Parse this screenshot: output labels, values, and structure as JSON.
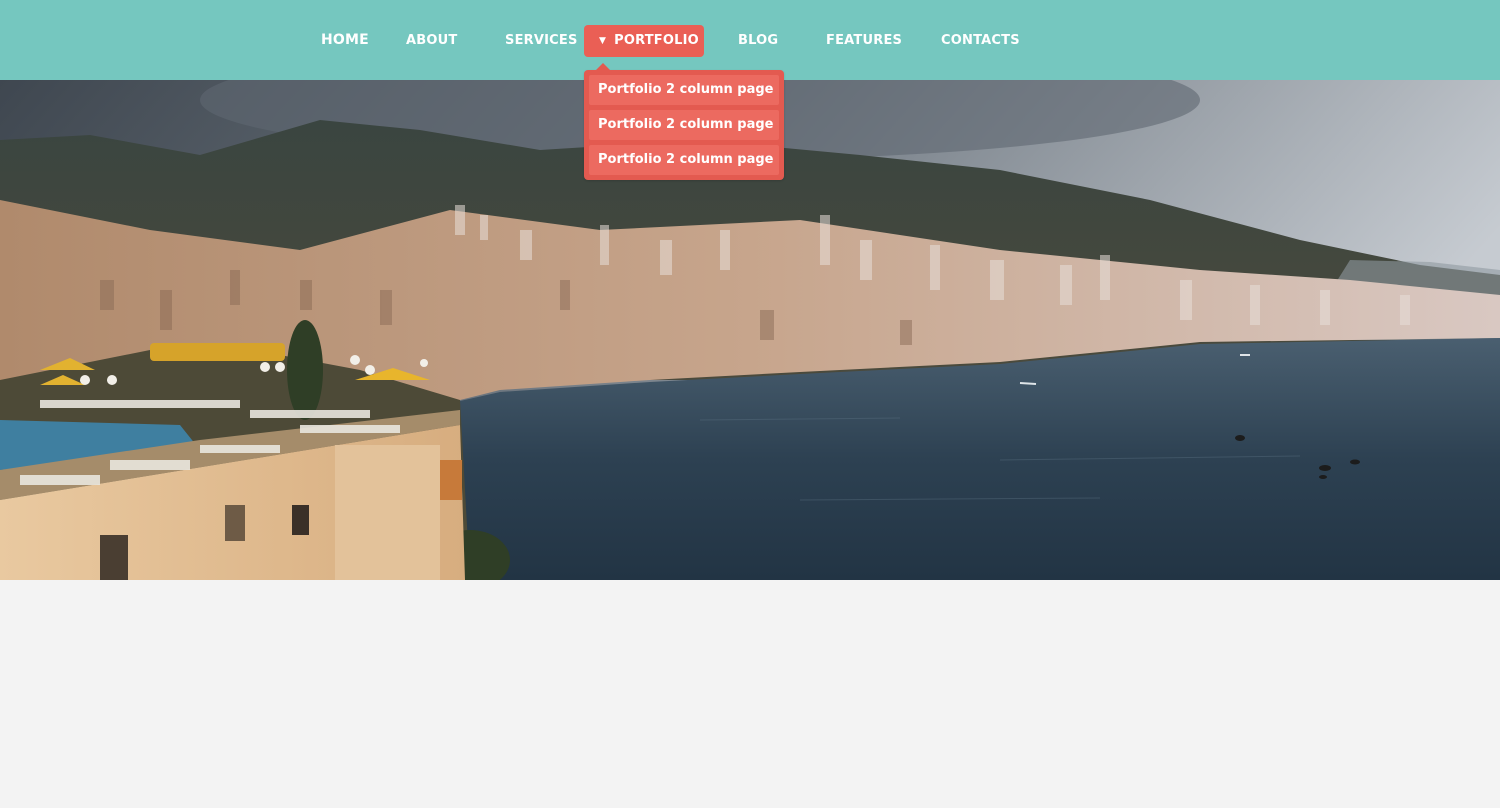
{
  "nav": {
    "items": [
      {
        "label": "HOME"
      },
      {
        "label": "ABOUT"
      },
      {
        "label": "SERVICES"
      },
      {
        "label": "PORTFOLIO"
      },
      {
        "label": "BLOG"
      },
      {
        "label": "FEATURES"
      },
      {
        "label": "CONTACTS"
      }
    ],
    "active_index": 3,
    "dropdown": [
      {
        "label": "Portfolio 2 column page"
      },
      {
        "label": "Portfolio 2 column page"
      },
      {
        "label": "Portfolio 2 column page"
      }
    ],
    "caret_icon": "caret-down-icon"
  },
  "colors": {
    "topbar": "#75c7bf",
    "accent": "#ea5f55",
    "dropdown_bg": "#e35a50",
    "dropdown_item": "#ec6a60",
    "page_bg": "#f3f3f3"
  },
  "hero": {
    "image": "coastal-city-panorama"
  }
}
